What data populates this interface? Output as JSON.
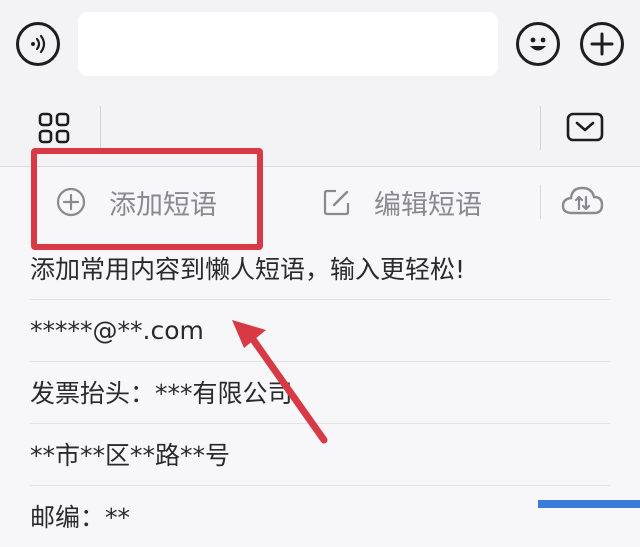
{
  "input_bar": {
    "text_value": "",
    "voice_icon": "voice-input-icon",
    "emoji_icon": "emoji-icon",
    "plus_icon": "plus-icon"
  },
  "toolbar": {
    "grid_icon": "grid-apps-icon",
    "collapse_icon": "keyboard-collapse-icon"
  },
  "phrases": {
    "add_label": "添加短语",
    "edit_label": "编辑短语",
    "cloud_icon": "cloud-sync-icon",
    "items": [
      "添加常用内容到懒人短语，输入更轻松!",
      "*****@**.com",
      "发票抬头：***有限公司",
      "**市**区**路**号",
      "邮编：**"
    ]
  },
  "annotation": {
    "highlight_color": "#d73a44"
  }
}
